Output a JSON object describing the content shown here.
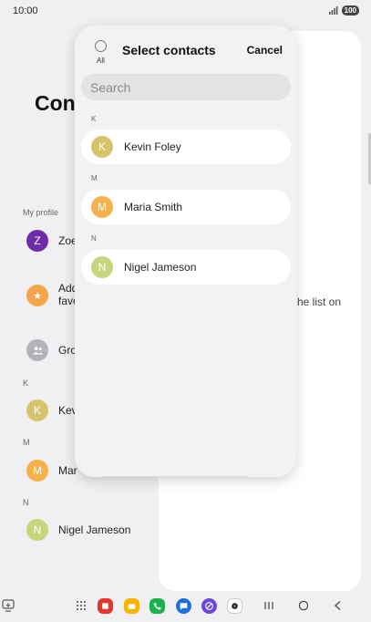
{
  "status": {
    "time": "10:00",
    "battery": "100"
  },
  "background": {
    "title": "Con",
    "my_profile_label": "My profile",
    "rows": [
      {
        "initial": "Z",
        "label": "Zoe",
        "color": "#6f2ca8"
      },
      {
        "initial": "★",
        "label": "Add",
        "label2": "favo",
        "color": "#f5a54b"
      },
      {
        "initial": "",
        "label": "Gro",
        "color": "#b2b2b8"
      }
    ],
    "sections": [
      {
        "letter": "K",
        "initial": "K",
        "label": "Kevi",
        "color": "#d6c46a"
      },
      {
        "letter": "M",
        "initial": "M",
        "label": "Mar",
        "color": "#f5b14b"
      },
      {
        "letter": "N",
        "initial": "N",
        "label": "Nigel Jameson",
        "color": "#c5d67c"
      }
    ],
    "right_pane_text": "he list on"
  },
  "sheet": {
    "all_label": "All",
    "title": "Select contacts",
    "cancel_label": "Cancel",
    "search_placeholder": "Search",
    "groups": [
      {
        "letter": "K",
        "contacts": [
          {
            "initial": "K",
            "name": "Kevin Foley",
            "color": "#d6c46a"
          }
        ]
      },
      {
        "letter": "M",
        "contacts": [
          {
            "initial": "M",
            "name": "Maria Smith",
            "color": "#f5b14b"
          }
        ]
      },
      {
        "letter": "N",
        "contacts": [
          {
            "initial": "N",
            "name": "Nigel Jameson",
            "color": "#c5d67c"
          }
        ]
      }
    ]
  },
  "navbar": {
    "apps": [
      {
        "name": "apps-grid-icon"
      },
      {
        "name": "app-red-icon",
        "color": "#e8342f"
      },
      {
        "name": "app-yellow-icon",
        "color": "#f4b400"
      },
      {
        "name": "phone-icon",
        "color": "#1cb04e"
      },
      {
        "name": "messages-icon",
        "color": "#1d6fe0"
      },
      {
        "name": "browser-icon",
        "color": "#6a47d8"
      },
      {
        "name": "camera-icon",
        "color": "#222222"
      }
    ]
  }
}
